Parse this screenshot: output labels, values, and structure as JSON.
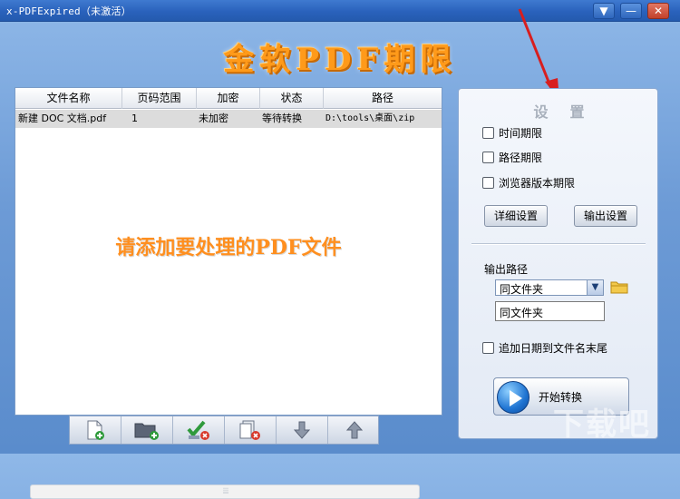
{
  "window": {
    "title": "x-PDFExpired（未激活）",
    "controls": {
      "menu": "▼",
      "minimize": "—",
      "close": "✕"
    }
  },
  "banner": {
    "text": "金软PDF期限"
  },
  "file_table": {
    "columns": [
      "文件名称",
      "页码范围",
      "加密",
      "状态",
      "路径"
    ],
    "rows": [
      [
        "新建 DOC 文档.pdf",
        "1",
        "未加密",
        "等待转换",
        "D:\\tools\\桌面\\zip"
      ]
    ],
    "placeholder": "请添加要处理的PDF文件",
    "scroll_grip": "⦙⦙⦙"
  },
  "toolbar": {
    "buttons": [
      {
        "icon": "add-file-icon"
      },
      {
        "icon": "add-folder-icon"
      },
      {
        "icon": "clear-checked-icon"
      },
      {
        "icon": "remove-file-icon"
      },
      {
        "icon": "move-down-icon"
      },
      {
        "icon": "move-up-icon"
      }
    ]
  },
  "settings": {
    "title": "设置",
    "options": [
      {
        "label": "时间期限",
        "checked": false
      },
      {
        "label": "路径期限",
        "checked": false
      },
      {
        "label": "浏览器版本期限",
        "checked": false
      }
    ],
    "detail_button": "详细设置",
    "output_button": "输出设置",
    "output_path_label": "输出路径",
    "output_path_select": "同文件夹",
    "output_path_value": "同文件夹",
    "append_date_label": "追加日期到文件名末尾",
    "append_date_checked": false,
    "start_button": "开始转换"
  },
  "watermark": {
    "text": "下载吧"
  },
  "colors": {
    "background": "#6d9bd6",
    "titlebar": "#2a62bc",
    "banner": "#ff9a1a",
    "annotation_arrow": "#d81e1e"
  }
}
